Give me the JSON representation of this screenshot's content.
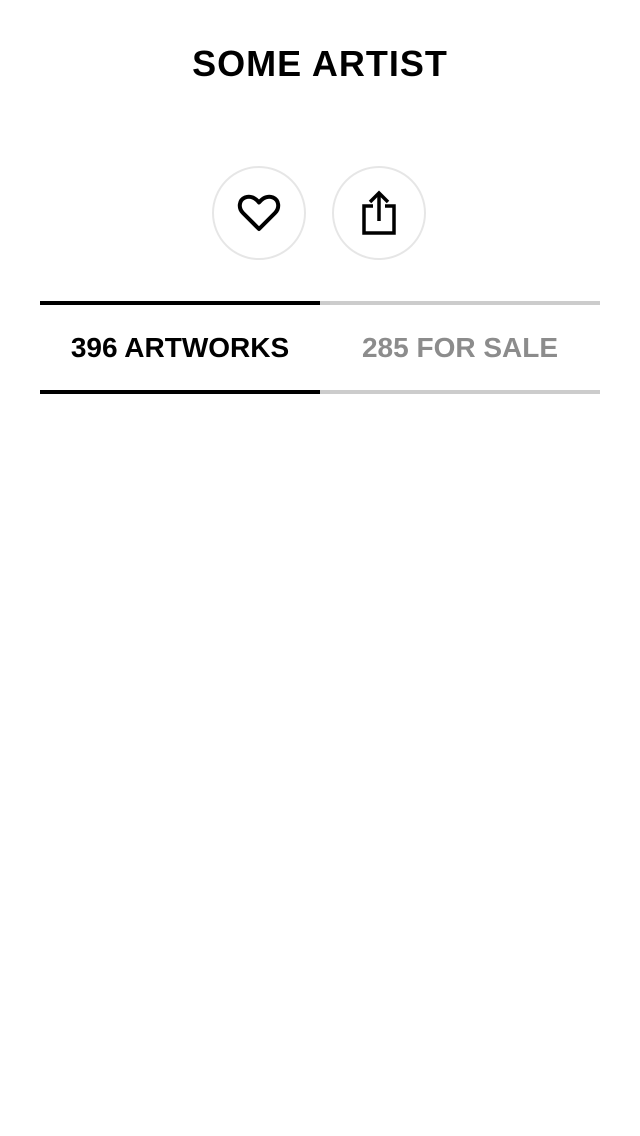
{
  "artist": {
    "name": "SOME ARTIST"
  },
  "actions": {
    "favorite_icon": "heart-icon",
    "share_icon": "share-icon"
  },
  "tabs": [
    {
      "label": "396 ARTWORKS",
      "active": true
    },
    {
      "label": "285 FOR SALE",
      "active": false
    }
  ],
  "colors": {
    "active_tab": "#000000",
    "inactive_tab_text": "#8c8c8c",
    "inactive_tab_line": "#cccccc",
    "button_border": "#e6e6e6"
  }
}
